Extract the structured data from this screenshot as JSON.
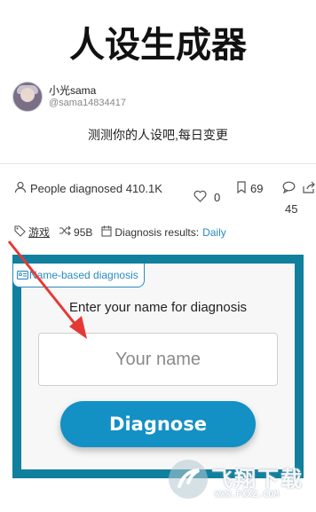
{
  "page": {
    "title": "人设生成器",
    "description": "测测你的人设吧,每日变更"
  },
  "author": {
    "name": "小光sama",
    "handle": "@sama14834417"
  },
  "stats": {
    "diagnosed_label": "People diagnosed",
    "diagnosed_count": "410.1K",
    "likes": "0",
    "bookmarks": "69",
    "comments": "45"
  },
  "meta": {
    "tag": "游戏",
    "size": "95B",
    "results_label": "Diagnosis results:",
    "results_value": "Daily"
  },
  "form": {
    "tab_label": "Name-based diagnosis",
    "prompt": "Enter your name for diagnosis",
    "input_placeholder": "Your name",
    "input_value": "",
    "submit_label": "Diagnose"
  },
  "watermark": {
    "text": "飞翔下载",
    "url": "WWW.FXXZ.COM"
  },
  "colors": {
    "accent": "#1390c4",
    "card_border": "#10809e",
    "link": "#2a8ac0",
    "annotation_arrow": "#e53935"
  },
  "icons": [
    "user-icon",
    "heart-icon",
    "bookmark-icon",
    "comment-icon",
    "share-icon",
    "tag-icon",
    "shuffle-icon",
    "calendar-icon",
    "id-card-icon"
  ]
}
